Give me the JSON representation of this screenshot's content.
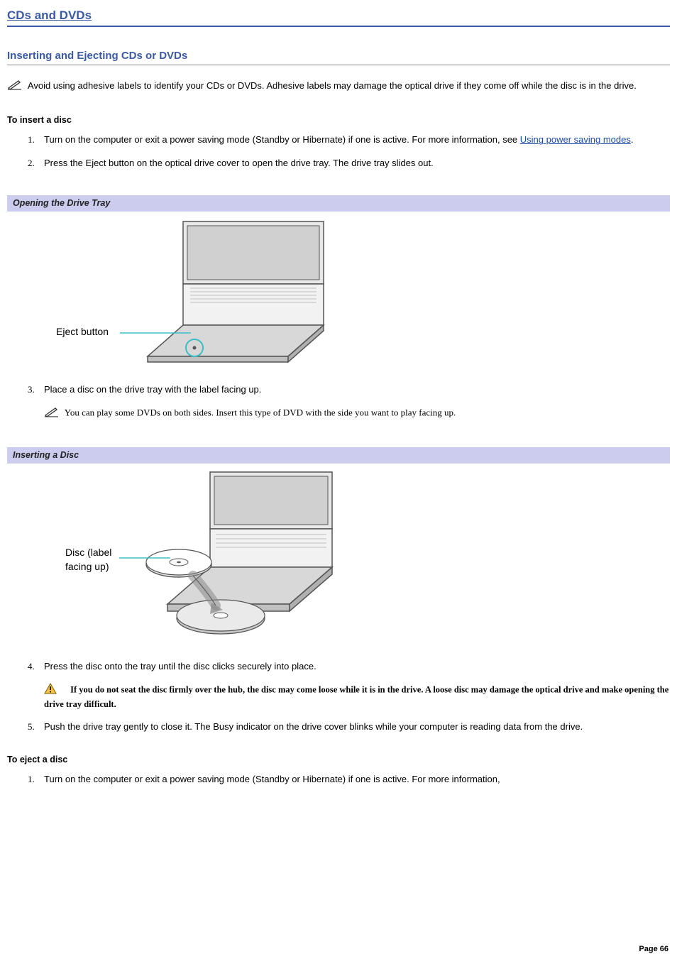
{
  "headings": {
    "main": "CDs and DVDs",
    "sub": "Inserting and Ejecting CDs or DVDs"
  },
  "note_intro": "Avoid using adhesive labels to identify your CDs or DVDs. Adhesive labels may damage the optical drive if they come off while the disc is in the drive.",
  "insert": {
    "label": "To insert a disc",
    "steps": {
      "s1_a": "Turn on the computer or exit a power saving mode (Standby or Hibernate) if one is active. For more information, see ",
      "s1_link": "Using power saving modes",
      "s1_b": ".",
      "s2": "Press the Eject button on the optical drive cover to open the drive tray. The drive tray slides out.",
      "s3": "Place a disc on the drive tray with the label facing up.",
      "s3_note": "You can play some DVDs on both sides. Insert this type of DVD with the side you want to play facing up.",
      "s4": "Press the disc onto the tray until the disc clicks securely into place.",
      "s4_warn": "If you do not seat the disc firmly over the hub, the disc may come loose while it is in the drive. A loose disc may damage the optical drive and make opening the drive tray difficult.",
      "s5": "Push the drive tray gently to close it. The Busy indicator on the drive cover blinks while your computer is reading data from the drive."
    }
  },
  "figures": {
    "f1_caption": "Opening the Drive Tray",
    "f1_label": "Eject button",
    "f2_caption": "Inserting a Disc",
    "f2_label_a": "Disc (label",
    "f2_label_b": "facing up)"
  },
  "eject": {
    "label": "To eject a disc",
    "steps": {
      "s1": "Turn on the computer or exit a power saving mode (Standby or Hibernate) if one is active. For more information,"
    }
  },
  "page_number": "Page 66"
}
